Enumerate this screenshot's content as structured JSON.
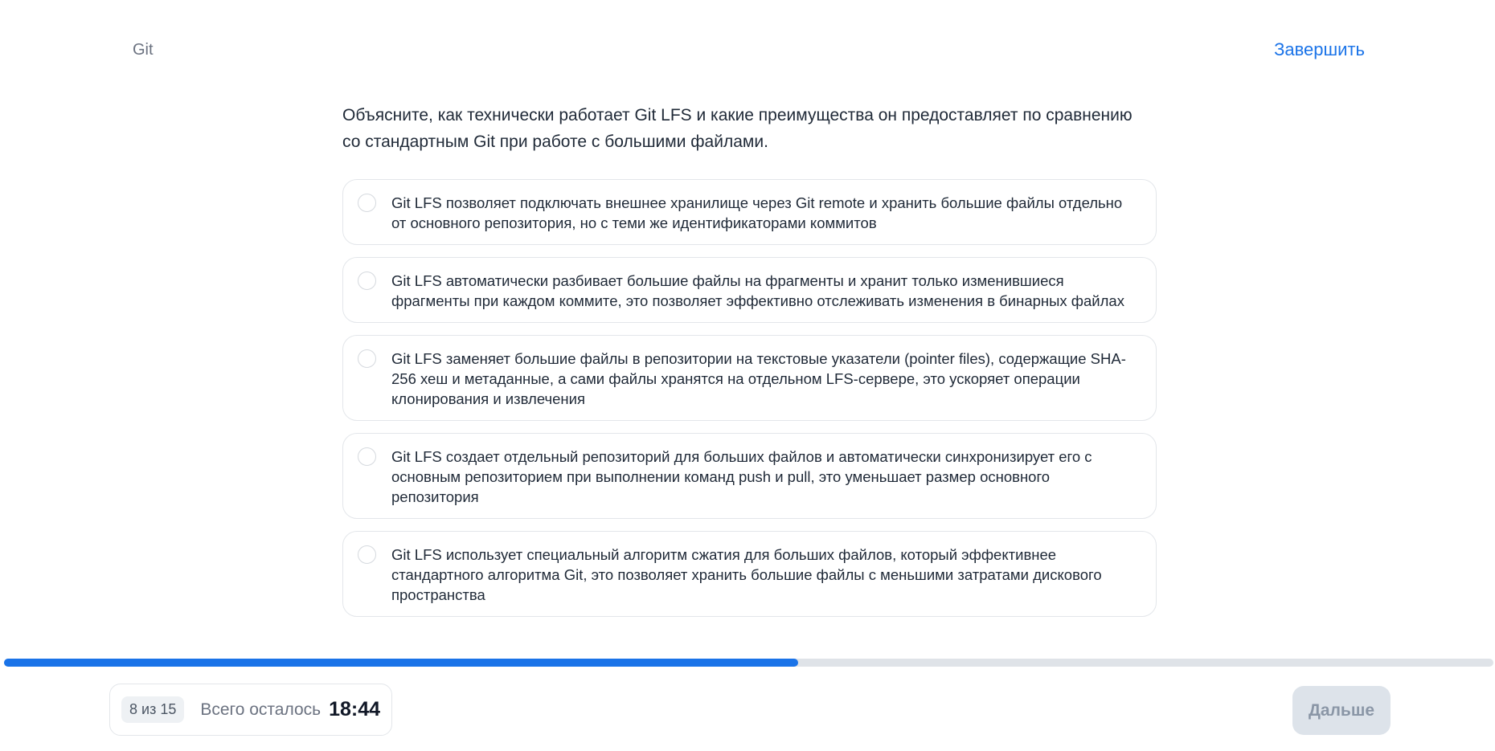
{
  "header": {
    "topic": "Git",
    "finish_label": "Завершить"
  },
  "question": {
    "text": "Объясните, как технически работает Git LFS и какие преимущества он предоставляет по сравнению со стандартным Git при работе с большими файлами."
  },
  "options": [
    {
      "text": "Git LFS позволяет подключать внешнее хранилище через Git remote и хранить большие файлы отдельно от основного репозитория, но с теми же идентификаторами коммитов"
    },
    {
      "text": "Git LFS автоматически разбивает большие файлы на фрагменты и хранит только изменившиеся фрагменты при каждом коммите, это позволяет эффективно отслеживать изменения в бинарных файлах"
    },
    {
      "text": "Git LFS заменяет большие файлы в репозитории на текстовые указатели (pointer files), содержащие SHA-256 хеш и метаданные, а сами файлы хранятся на отдельном LFS-сервере, это ускоряет операции клонирования и извлечения"
    },
    {
      "text": "Git LFS создает отдельный репозиторий для больших файлов и автоматически синхронизирует его с основным репозиторием при выполнении команд push и pull, это уменьшает размер основного репозитория"
    },
    {
      "text": "Git LFS использует специальный алгоритм сжатия для больших файлов, который эффективнее стандартного алгоритма Git, это позволяет хранить большие файлы с меньшими затратами дискового пространства"
    }
  ],
  "progress": {
    "fraction": 0.533
  },
  "footer": {
    "counter": "8 из 15",
    "remaining_label": "Всего осталось",
    "timer": "18:44",
    "next_label": "Дальше"
  },
  "colors": {
    "accent": "#1a73e8",
    "track": "#dfe3e8",
    "disabled_button": "#dde3ea"
  }
}
